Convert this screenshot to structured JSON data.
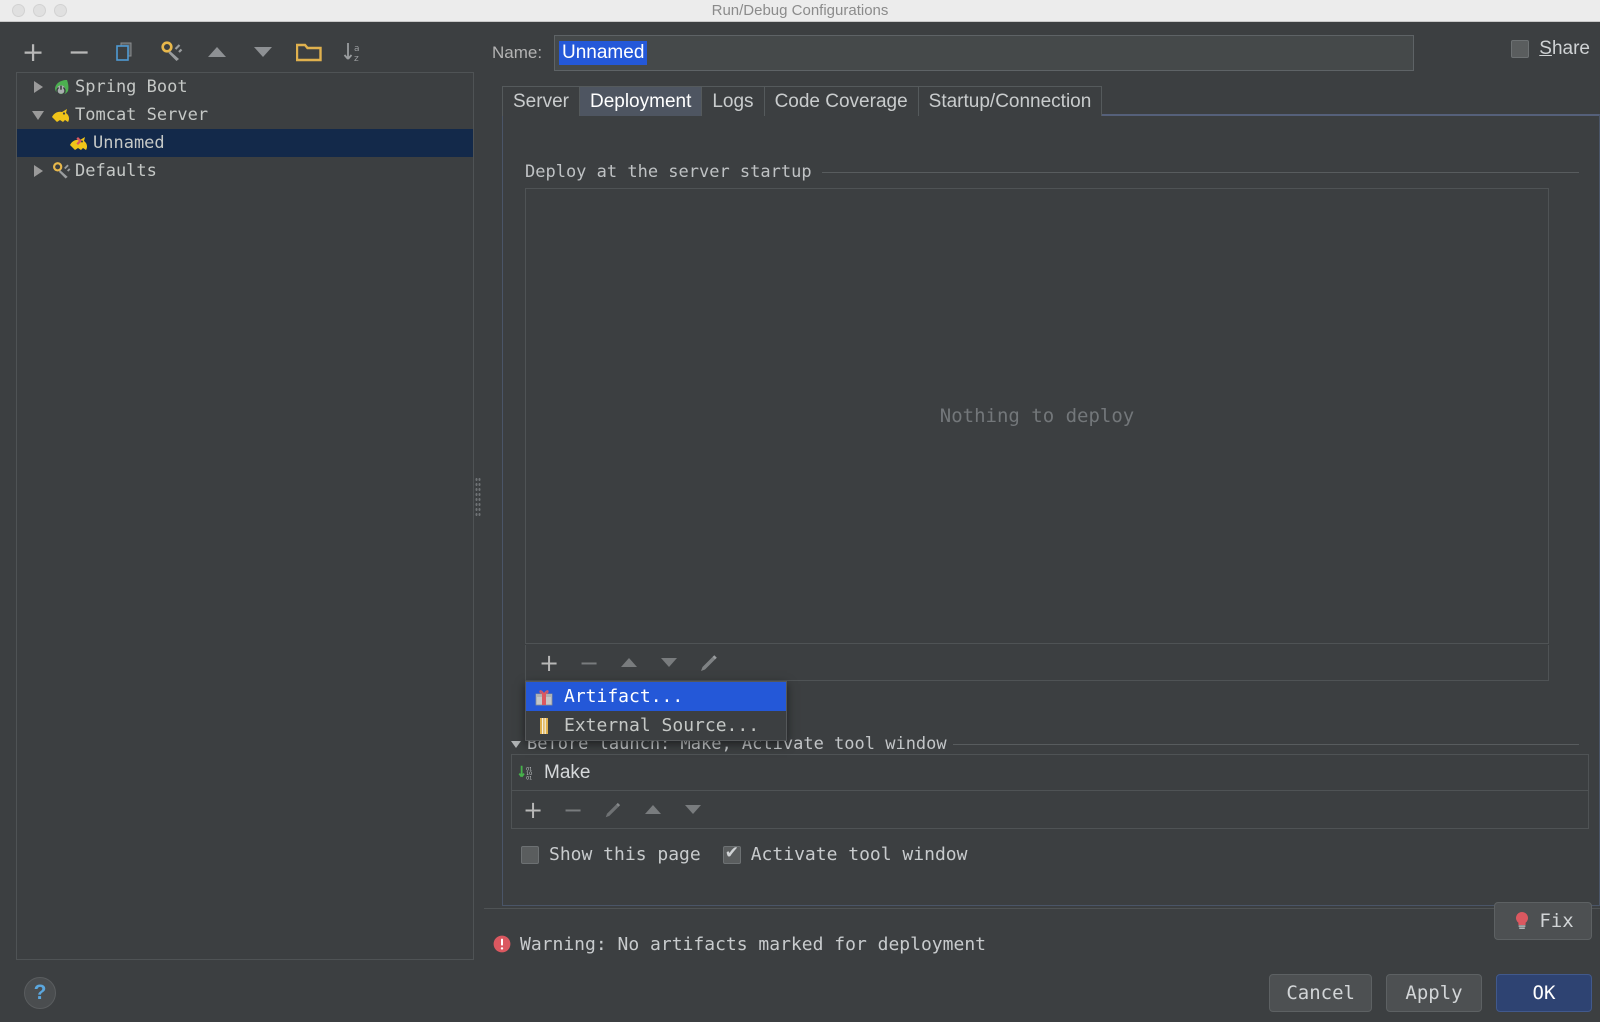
{
  "window": {
    "title": "Run/Debug Configurations",
    "traffic_lights": [
      "close",
      "minimize",
      "zoom"
    ]
  },
  "sidebar": {
    "toolbar": [
      {
        "name": "add-configuration-icon",
        "glyph": "+"
      },
      {
        "name": "remove-configuration-icon",
        "glyph": "−"
      },
      {
        "name": "copy-configuration-icon",
        "glyph": "copy"
      },
      {
        "name": "edit-defaults-icon",
        "glyph": "wrench"
      },
      {
        "name": "move-up-icon",
        "glyph": "triangle-up"
      },
      {
        "name": "move-down-icon",
        "glyph": "triangle-down"
      },
      {
        "name": "create-folder-icon",
        "glyph": "folder"
      },
      {
        "name": "sort-alphabetically-icon",
        "glyph": "sort-az"
      }
    ],
    "tree": [
      {
        "label": "Spring Boot",
        "expanded": false,
        "icon": "spring-boot-icon",
        "level": 0,
        "selected": false
      },
      {
        "label": "Tomcat Server",
        "expanded": true,
        "icon": "tomcat-icon",
        "level": 0,
        "selected": false
      },
      {
        "label": "Unnamed",
        "expanded": null,
        "icon": "tomcat-run-icon",
        "level": 1,
        "selected": true
      },
      {
        "label": "Defaults",
        "expanded": false,
        "icon": "wrench-icon",
        "level": 0,
        "selected": false
      }
    ]
  },
  "name_field": {
    "label": "Name:",
    "value": "Unnamed",
    "placeholder": ""
  },
  "share": {
    "label": "Share",
    "mnemonic": "S",
    "rest": "hare",
    "checked": false
  },
  "tabs": [
    {
      "label": "Server",
      "active": false
    },
    {
      "label": "Deployment",
      "active": true
    },
    {
      "label": "Logs",
      "active": false
    },
    {
      "label": "Code Coverage",
      "active": false
    },
    {
      "label": "Startup/Connection",
      "active": false
    }
  ],
  "deployment": {
    "section_title": "Deploy at the server startup",
    "empty_message": "Nothing to deploy",
    "toolbar": [
      {
        "name": "add-artifact-icon",
        "glyph": "+",
        "enabled": true
      },
      {
        "name": "remove-artifact-icon",
        "glyph": "−",
        "enabled": false
      },
      {
        "name": "move-up-icon",
        "glyph": "triangle-up",
        "enabled": false
      },
      {
        "name": "move-down-icon",
        "glyph": "triangle-down",
        "enabled": false
      },
      {
        "name": "edit-artifact-icon",
        "glyph": "pencil",
        "enabled": false
      }
    ],
    "popup_menu": [
      {
        "label": "Artifact...",
        "icon": "artifact-package-icon",
        "highlighted": true
      },
      {
        "label": "External Source...",
        "icon": "external-source-icon",
        "highlighted": false
      }
    ]
  },
  "before_launch": {
    "title": "Before launch: Make, Activate tool window",
    "expanded": true,
    "items": [
      {
        "label": "Make",
        "icon": "make-build-icon"
      }
    ],
    "toolbar": [
      {
        "name": "add-task-icon",
        "glyph": "+",
        "enabled": true
      },
      {
        "name": "remove-task-icon",
        "glyph": "−",
        "enabled": false
      },
      {
        "name": "edit-task-icon",
        "glyph": "pencil",
        "enabled": false
      },
      {
        "name": "move-up-icon",
        "glyph": "triangle-up",
        "enabled": false
      },
      {
        "name": "move-down-icon",
        "glyph": "triangle-down",
        "enabled": false
      }
    ],
    "checkboxes": [
      {
        "label": "Show this page",
        "checked": false
      },
      {
        "label": "Activate tool window",
        "checked": true
      }
    ]
  },
  "warning": {
    "icon": "error-circle-icon",
    "text": "Warning: No artifacts marked for deployment",
    "fix_label": "Fix",
    "fix_icon": "lightbulb-icon"
  },
  "buttons": {
    "cancel": "Cancel",
    "apply": "Apply",
    "ok": "OK",
    "help": "?"
  },
  "colors": {
    "background": "#3c3f41",
    "selection_blue": "#2458d8",
    "tree_selection": "#13294a",
    "accent_ok": "#2e4372",
    "warning_red": "#db5860",
    "tab_active": "#4e5561"
  }
}
